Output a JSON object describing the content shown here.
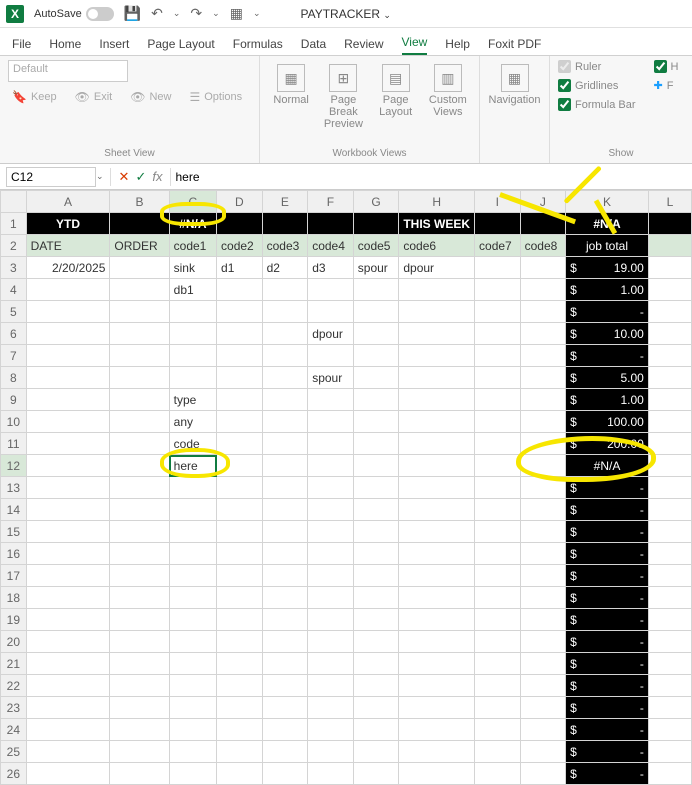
{
  "titlebar": {
    "autosave_label": "AutoSave",
    "docname": "PAYTRACKER",
    "icons": {
      "save": "💾",
      "undo": "↶",
      "redo": "↷",
      "grid": "▦",
      "dropdown": "⌄"
    }
  },
  "menutabs": [
    "File",
    "Home",
    "Insert",
    "Page Layout",
    "Formulas",
    "Data",
    "Review",
    "View",
    "Help",
    "Foxit PDF"
  ],
  "active_tab": "View",
  "ribbon": {
    "sheetview": {
      "default": "Default",
      "keep": "Keep",
      "exit": "Exit",
      "new": "New",
      "options": "Options",
      "label": "Sheet View"
    },
    "workbookviews": {
      "normal": "Normal",
      "pagebreak": "Page Break Preview",
      "pagelayout": "Page Layout",
      "custom": "Custom Views",
      "label": "Workbook Views"
    },
    "navigation": {
      "nav": "Navigation"
    },
    "show": {
      "ruler": "Ruler",
      "gridlines": "Gridlines",
      "formulabar": "Formula Bar",
      "h": "H",
      "f": "F",
      "label": "Show"
    }
  },
  "formulabar": {
    "namebox": "C12",
    "fx": "fx",
    "value": "here"
  },
  "columns": [
    "A",
    "B",
    "C",
    "D",
    "E",
    "F",
    "G",
    "H",
    "I",
    "J",
    "K",
    "L"
  ],
  "active_col": "C",
  "active_row": 12,
  "rows": [
    {
      "n": 1,
      "cls": "r1",
      "A": "YTD",
      "B": "",
      "C": "#N/A",
      "D": "",
      "E": "",
      "F": "",
      "G": "",
      "H": "THIS WEEK",
      "I": "",
      "J": "",
      "K": "#N/A",
      "L": ""
    },
    {
      "n": 2,
      "cls": "r2",
      "A": "DATE",
      "B": "ORDER",
      "C": "code1",
      "D": "code2",
      "E": "code3",
      "F": "code4",
      "G": "code5",
      "H": "code6",
      "I": "code7",
      "J": "code8",
      "K": "job total",
      "L": ""
    },
    {
      "n": 3,
      "A": "2/20/2025",
      "B": "",
      "C": "sink",
      "D": "d1",
      "E": "d2",
      "F": "d3",
      "G": "spour",
      "H": "dpour",
      "I": "",
      "J": "",
      "K": "19.00",
      "L": ""
    },
    {
      "n": 4,
      "A": "",
      "B": "",
      "C": "db1",
      "D": "",
      "E": "",
      "F": "",
      "G": "",
      "H": "",
      "I": "",
      "J": "",
      "K": "1.00",
      "L": ""
    },
    {
      "n": 5,
      "A": "",
      "B": "",
      "C": "",
      "D": "",
      "E": "",
      "F": "",
      "G": "",
      "H": "",
      "I": "",
      "J": "",
      "K": "-",
      "L": ""
    },
    {
      "n": 6,
      "A": "",
      "B": "",
      "C": "",
      "D": "",
      "E": "",
      "F": "dpour",
      "G": "",
      "H": "",
      "I": "",
      "J": "",
      "K": "10.00",
      "L": ""
    },
    {
      "n": 7,
      "A": "",
      "B": "",
      "C": "",
      "D": "",
      "E": "",
      "F": "",
      "G": "",
      "H": "",
      "I": "",
      "J": "",
      "K": "-",
      "L": ""
    },
    {
      "n": 8,
      "A": "",
      "B": "",
      "C": "",
      "D": "",
      "E": "",
      "F": "spour",
      "G": "",
      "H": "",
      "I": "",
      "J": "",
      "K": "5.00",
      "L": ""
    },
    {
      "n": 9,
      "A": "",
      "B": "",
      "C": "type",
      "D": "",
      "E": "",
      "F": "",
      "G": "",
      "H": "",
      "I": "",
      "J": "",
      "K": "1.00",
      "L": ""
    },
    {
      "n": 10,
      "A": "",
      "B": "",
      "C": "any",
      "D": "",
      "E": "",
      "F": "",
      "G": "",
      "H": "",
      "I": "",
      "J": "",
      "K": "100.00",
      "L": ""
    },
    {
      "n": 11,
      "A": "",
      "B": "",
      "C": "code",
      "D": "",
      "E": "",
      "F": "",
      "G": "",
      "H": "",
      "I": "",
      "J": "",
      "K": "200.00",
      "L": ""
    },
    {
      "n": 12,
      "A": "",
      "B": "",
      "C": "here",
      "D": "",
      "E": "",
      "F": "",
      "G": "",
      "H": "",
      "I": "",
      "J": "",
      "K": "#N/A",
      "L": "",
      "active": "C"
    },
    {
      "n": 13,
      "A": "",
      "B": "",
      "C": "",
      "D": "",
      "E": "",
      "F": "",
      "G": "",
      "H": "",
      "I": "",
      "J": "",
      "K": "-",
      "L": ""
    },
    {
      "n": 14,
      "A": "",
      "B": "",
      "C": "",
      "D": "",
      "E": "",
      "F": "",
      "G": "",
      "H": "",
      "I": "",
      "J": "",
      "K": "-",
      "L": ""
    },
    {
      "n": 15,
      "A": "",
      "B": "",
      "C": "",
      "D": "",
      "E": "",
      "F": "",
      "G": "",
      "H": "",
      "I": "",
      "J": "",
      "K": "-",
      "L": ""
    },
    {
      "n": 16,
      "A": "",
      "B": "",
      "C": "",
      "D": "",
      "E": "",
      "F": "",
      "G": "",
      "H": "",
      "I": "",
      "J": "",
      "K": "-",
      "L": ""
    },
    {
      "n": 17,
      "A": "",
      "B": "",
      "C": "",
      "D": "",
      "E": "",
      "F": "",
      "G": "",
      "H": "",
      "I": "",
      "J": "",
      "K": "-",
      "L": ""
    },
    {
      "n": 18,
      "A": "",
      "B": "",
      "C": "",
      "D": "",
      "E": "",
      "F": "",
      "G": "",
      "H": "",
      "I": "",
      "J": "",
      "K": "-",
      "L": ""
    },
    {
      "n": 19,
      "A": "",
      "B": "",
      "C": "",
      "D": "",
      "E": "",
      "F": "",
      "G": "",
      "H": "",
      "I": "",
      "J": "",
      "K": "-",
      "L": ""
    },
    {
      "n": 20,
      "A": "",
      "B": "",
      "C": "",
      "D": "",
      "E": "",
      "F": "",
      "G": "",
      "H": "",
      "I": "",
      "J": "",
      "K": "-",
      "L": ""
    },
    {
      "n": 21,
      "A": "",
      "B": "",
      "C": "",
      "D": "",
      "E": "",
      "F": "",
      "G": "",
      "H": "",
      "I": "",
      "J": "",
      "K": "-",
      "L": ""
    },
    {
      "n": 22,
      "A": "",
      "B": "",
      "C": "",
      "D": "",
      "E": "",
      "F": "",
      "G": "",
      "H": "",
      "I": "",
      "J": "",
      "K": "-",
      "L": ""
    },
    {
      "n": 23,
      "A": "",
      "B": "",
      "C": "",
      "D": "",
      "E": "",
      "F": "",
      "G": "",
      "H": "",
      "I": "",
      "J": "",
      "K": "-",
      "L": ""
    },
    {
      "n": 24,
      "A": "",
      "B": "",
      "C": "",
      "D": "",
      "E": "",
      "F": "",
      "G": "",
      "H": "",
      "I": "",
      "J": "",
      "K": "-",
      "L": ""
    },
    {
      "n": 25,
      "A": "",
      "B": "",
      "C": "",
      "D": "",
      "E": "",
      "F": "",
      "G": "",
      "H": "",
      "I": "",
      "J": "",
      "K": "-",
      "L": ""
    },
    {
      "n": 26,
      "A": "",
      "B": "",
      "C": "",
      "D": "",
      "E": "",
      "F": "",
      "G": "",
      "H": "",
      "I": "",
      "J": "",
      "K": "-",
      "L": ""
    }
  ]
}
